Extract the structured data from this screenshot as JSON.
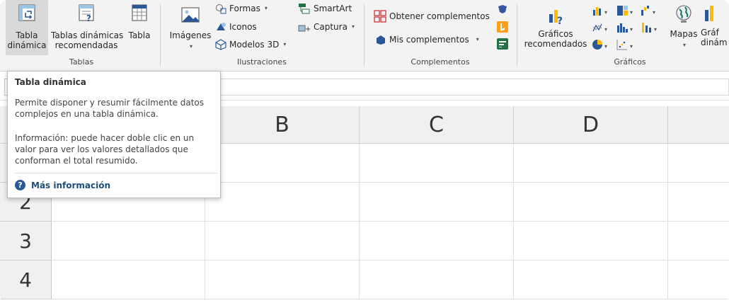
{
  "ribbon": {
    "tablas": {
      "pivot_label_1": "Tabla",
      "pivot_label_2": "dinámica",
      "recommended_label_1": "Tablas dinámicas",
      "recommended_label_2": "recomendadas",
      "table_label": "Tabla",
      "group_label": "Tablas"
    },
    "ilustraciones": {
      "images_label": "Imágenes",
      "shapes_label": "Formas",
      "icons_label": "Iconos",
      "models_label": "Modelos 3D",
      "smartart_label": "SmartArt",
      "screenshot_label": "Captura",
      "group_label": "Ilustraciones"
    },
    "complementos": {
      "get_label": "Obtener complementos",
      "my_label": "Mis complementos",
      "group_label": "Complementos"
    },
    "graficos": {
      "recommended_label_1": "Gráficos",
      "recommended_label_2": "recomendados",
      "maps_label": "Mapas",
      "pivot_chart_label_1": "Gráf",
      "pivot_chart_label_2": "dinám",
      "group_label": "Gráficos"
    }
  },
  "grid": {
    "columns": [
      "B",
      "C",
      "D"
    ],
    "rows": [
      "2",
      "3",
      "4"
    ]
  },
  "tooltip": {
    "title": "Tabla dinámica",
    "description": "Permite disponer y resumir fácilmente datos complejos en una tabla dinámica.",
    "info": "Información: puede hacer doble clic en un valor para ver los valores detallados que conforman el total resumido.",
    "link": "Más información"
  },
  "colors": {
    "accent": "#217346",
    "link": "#1e4e79",
    "help_icon": "#2b5797"
  }
}
